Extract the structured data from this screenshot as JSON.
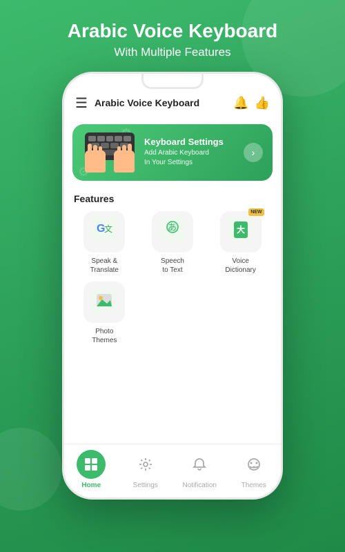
{
  "header": {
    "title": "Arabic Voice Keyboard",
    "subtitle": "With Multiple Features"
  },
  "appBar": {
    "appName": "Arabic Voice Keyboard",
    "menuIcon": "☰",
    "bellIcon": "🔔",
    "thumbIcon": "👍"
  },
  "banner": {
    "title": "Keyboard Settings",
    "subtitle": "Add Arabic Keyboard\nIn Your Settings",
    "arrowIcon": "›"
  },
  "features": {
    "label": "Features",
    "items": [
      {
        "id": "speak-translate",
        "icon": "🇬",
        "label": "Speak &\nTranslate",
        "badge": null
      },
      {
        "id": "speech-to-text",
        "icon": "あ",
        "label": "Speech\nto Text",
        "badge": null
      },
      {
        "id": "voice-dictionary",
        "icon": "大",
        "label": "Voice\nDictionary",
        "badge": "NEW"
      },
      {
        "id": "photo-themes",
        "icon": "🖼",
        "label": "Photo\nThemes",
        "badge": null
      }
    ]
  },
  "bottomNav": {
    "items": [
      {
        "id": "home",
        "label": "Home",
        "icon": "⊞",
        "active": true
      },
      {
        "id": "settings",
        "label": "Settings",
        "icon": "⚙",
        "active": false
      },
      {
        "id": "notification",
        "label": "Notification",
        "icon": "🔔",
        "active": false
      },
      {
        "id": "themes",
        "label": "Themes",
        "icon": "🎨",
        "active": false
      }
    ]
  },
  "colors": {
    "primary": "#3dba6c",
    "primaryDark": "#2da05a",
    "accent": "#f0c040"
  }
}
